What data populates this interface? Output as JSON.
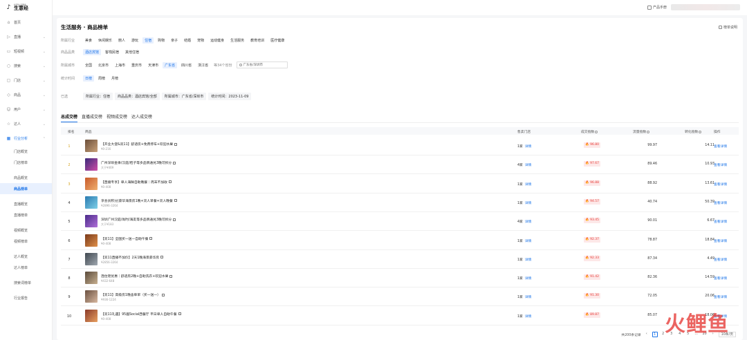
{
  "brand": {
    "sub": "抖音生活服务",
    "main": "生意经"
  },
  "sidebar": {
    "items": [
      {
        "label": "首页",
        "icon": "home-icon",
        "chev": ""
      },
      {
        "label": "直播",
        "icon": "live-icon",
        "chev": "⌄"
      },
      {
        "label": "短视频",
        "icon": "video-icon",
        "chev": "⌄"
      },
      {
        "label": "搜索",
        "icon": "search-icon",
        "chev": "⌄"
      },
      {
        "label": "门店",
        "icon": "store-icon",
        "chev": "⌄"
      },
      {
        "label": "商品",
        "icon": "goods-icon",
        "chev": "⌄"
      },
      {
        "label": "用户",
        "icon": "user-icon",
        "chev": "⌄"
      },
      {
        "label": "达人",
        "icon": "talent-icon",
        "chev": "⌄"
      },
      {
        "label": "行业分析",
        "icon": "analysis-icon",
        "chev": "⌃"
      }
    ],
    "sub": [
      "门店概览",
      "门店榜单",
      "商品概览",
      "商品榜单",
      "直播概览",
      "直播榜单",
      "视频概览",
      "视频榜单",
      "达人概览",
      "达人榜单",
      "搜索词榜单",
      "行业报告"
    ]
  },
  "topbar": {
    "handbook": "产品手册"
  },
  "main": {
    "title": "生活服务 · 商品榜单",
    "rule": "榜单说明",
    "filters": {
      "industry": {
        "label": "所属行业",
        "chips": [
          "美食",
          "休闲娱乐",
          "丽人",
          "游玩",
          "住宿",
          "购物",
          "亲子",
          "结婚",
          "宠物",
          "运动健身",
          "生活服务",
          "教育培训",
          "医疗健康"
        ]
      },
      "category": {
        "label": "商品品类",
        "chips": [
          "酒店宾馆",
          "客栈民宿",
          "其他住宿"
        ]
      },
      "city": {
        "label": "所属城市",
        "chips": [
          "全国",
          "北京市",
          "上海市",
          "重庆市",
          "天津市",
          "广东省",
          "四川省",
          "浙江省"
        ],
        "more": "等34个省份",
        "search": "广东省/深圳市"
      },
      "period": {
        "label": "统计时间",
        "chips": [
          "日榜",
          "周榜",
          "月榜"
        ]
      }
    },
    "selected": {
      "label": "已选",
      "tags": [
        "所属行业：住宿",
        "商品品类：酒店宾馆/全部",
        "所属城市：广东省/深圳市",
        "统计时间：2023-11-09"
      ]
    },
    "tabs": [
      "总成交榜",
      "直播成交榜",
      "视频成交榜",
      "达人成交榜"
    ],
    "columns": {
      "rank": "排名",
      "product": "商品",
      "store": "售卖门店",
      "deal": "成交指数",
      "traffic": "流量指数",
      "conv": "转化指数",
      "op": "操作"
    },
    "detail_label": "详情",
    "op_label": "查看详情",
    "rows": [
      {
        "rank": "1",
        "name": "【开业大促&双11】舒适房+免费停车+欢迎水果",
        "price": "¥0-216",
        "store": "1家",
        "deal": "96.80",
        "traffic": "99.97",
        "conv": "14.11"
      },
      {
        "rank": "2",
        "name": "广州深圳金季/汉庭/桔子等多品牌通兑3晚可拆分",
        "price": "大于¥469",
        "store": "4家",
        "deal": "97.67",
        "traffic": "89.46",
        "conv": "10.93"
      },
      {
        "rank": "3",
        "name": "【直播专享】单人海鲜自助晚餐｜周末不加收",
        "price": "¥0-408",
        "store": "1家",
        "deal": "96.88",
        "traffic": "88.92",
        "conv": "13.61"
      },
      {
        "rank": "4",
        "name": "享会员积分|豪华海景房1晚+双人早餐+双人晚餐",
        "price": "¥2896-3264",
        "store": "1家",
        "deal": "94.57",
        "traffic": "40.74",
        "conv": "50.39"
      },
      {
        "rank": "5",
        "name": "深圳广州汉庭/尚时/海友等多品牌通兑3晚可拆分",
        "price": "大于¥183",
        "store": "4家",
        "deal": "93.45",
        "traffic": "90.01",
        "conv": "6.67"
      },
      {
        "rank": "6",
        "name": "【双11】全国买一送一自助午餐",
        "price": "¥0-408",
        "store": "1家",
        "deal": "92.37",
        "traffic": "78.87",
        "conv": "18.84"
      },
      {
        "rank": "7",
        "name": "【双11直播不加价】2天1晚海景豪华房",
        "price": "¥2856-3264",
        "store": "1家",
        "deal": "92.33",
        "traffic": "87.34",
        "conv": "4.49"
      },
      {
        "rank": "8",
        "name": "连住钜优惠｜舒适房2晚+自助洗衣+欢迎水果",
        "price": "¥432-648",
        "store": "1家",
        "deal": "91.42",
        "traffic": "82.36",
        "conv": "14.59"
      },
      {
        "rank": "9",
        "name": "【双11】高级房1晚含单早（买一送一）",
        "price": "¥936-1224",
        "store": "1家",
        "deal": "91.30",
        "traffic": "72.05",
        "conv": "20.06"
      },
      {
        "rank": "10",
        "name": "【双11礼遇】95届Social西餐厅 平日单人自助午餐",
        "price": "¥0-408",
        "store": "1家",
        "deal": "89.87",
        "traffic": "85.07",
        "conv": "18.06"
      }
    ],
    "pagination": {
      "total": "共200条记录",
      "pages": [
        "1",
        "2",
        "3",
        "4",
        "5",
        "...",
        "20"
      ],
      "size": "10条/页"
    }
  },
  "watermark": "火鲤鱼",
  "colors": {
    "accent": "#1a73e8",
    "deal_red": "#e53935"
  }
}
